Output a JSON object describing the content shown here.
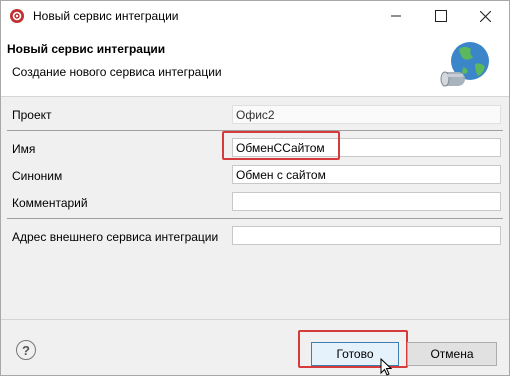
{
  "window": {
    "title": "Новый сервис интеграции"
  },
  "header": {
    "title": "Новый сервис интеграции",
    "subtitle": "Создание нового сервиса интеграции"
  },
  "form": {
    "project": {
      "label": "Проект",
      "value": "Офис2"
    },
    "name": {
      "label": "Имя",
      "value": "ОбменССайтом"
    },
    "synonym": {
      "label": "Синоним",
      "value": "Обмен с сайтом"
    },
    "comment": {
      "label": "Комментарий",
      "value": ""
    },
    "address": {
      "label": "Адрес внешнего сервиса интеграции",
      "value": ""
    }
  },
  "footer": {
    "ok_label": "Готово",
    "cancel_label": "Отмена",
    "help_icon": "?"
  },
  "colors": {
    "highlight": "#d63a3a",
    "primary_button_border": "#3c7fb1",
    "primary_button_bg": "#e5f1fb"
  }
}
